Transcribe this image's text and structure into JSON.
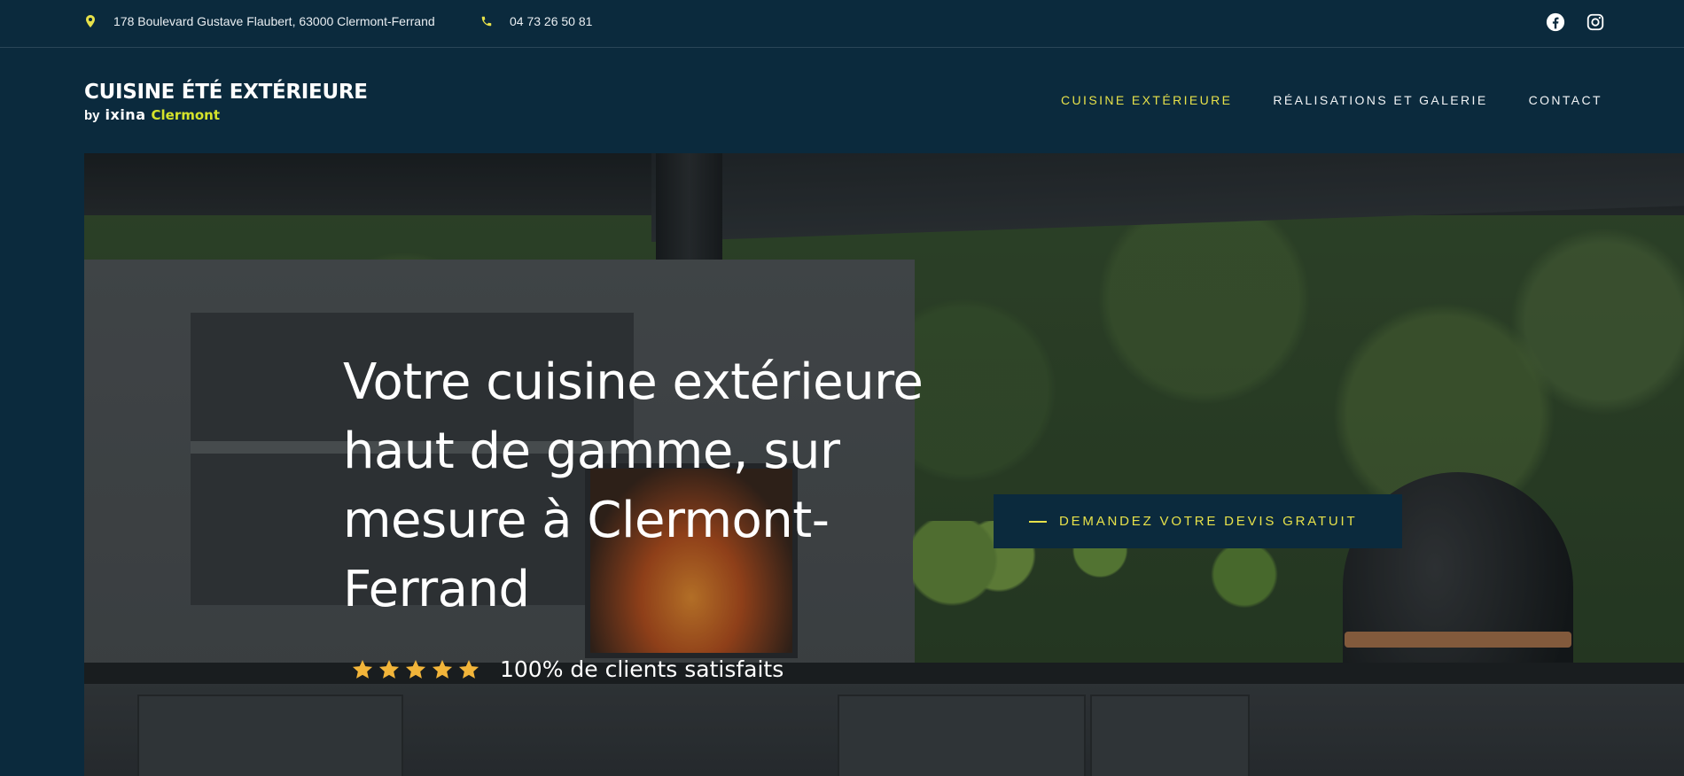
{
  "topbar": {
    "address": "178 Boulevard Gustave Flaubert, 63000 Clermont-Ferrand",
    "phone": "04 73 26 50 81",
    "address_icon": "map-pin-icon",
    "phone_icon": "phone-icon",
    "social": [
      "facebook-icon",
      "instagram-icon"
    ]
  },
  "logo": {
    "title": "CUISINE ÉTÉ EXTÉRIEURE",
    "by": "by",
    "brand": "ixina",
    "city": "Clermont"
  },
  "nav": {
    "items": [
      {
        "label": "CUISINE EXTÉRIEURE",
        "active": true
      },
      {
        "label": "RÉALISATIONS ET GALERIE",
        "active": false
      },
      {
        "label": "CONTACT",
        "active": false
      }
    ]
  },
  "hero": {
    "title": "Votre cuisine extérieure haut de gamme, sur mesure à Clermont-Ferrand",
    "rating_stars": 5,
    "rating_text": "100% de clients satisfaits",
    "cta_label": "DEMANDEZ VOTRE DEVIS GRATUIT"
  },
  "colors": {
    "background": "#0b2a3d",
    "accent": "#e7e14a",
    "star": "#f2b53a",
    "logo_city": "#d5e32b"
  }
}
